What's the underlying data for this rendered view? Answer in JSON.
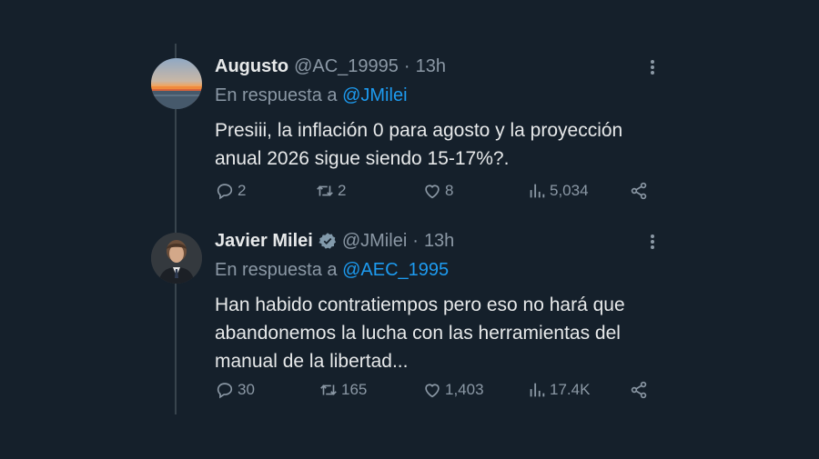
{
  "tweets": [
    {
      "display_name": "Augusto",
      "handle": "@AC_19995",
      "separator": "·",
      "time": "13h",
      "verified": false,
      "reply_prefix": "En respuesta a",
      "reply_to": "@JMilei",
      "text_lines": [
        "Presiii, la inflación 0 para agosto y la proyección",
        "anual 2026 sigue siendo 15-17%?."
      ],
      "replies": "2",
      "retweets": "2",
      "likes": "8",
      "views": "5,034"
    },
    {
      "display_name": "Javier Milei",
      "handle": "@JMilei",
      "separator": "·",
      "time": "13h",
      "verified": true,
      "reply_prefix": "En respuesta a",
      "reply_to": "@AEC_1995",
      "text_lines": [
        "Han habido contratiempos pero eso no hará que",
        "abandonemos la lucha con las herramientas del",
        "manual de la libertad..."
      ],
      "replies": "30",
      "retweets": "165",
      "likes": "1,403",
      "views": "17.4K"
    }
  ],
  "colors": {
    "background": "#15202b",
    "text": "#e7e9ea",
    "muted": "#8b98a5",
    "accent": "#1d9bf0",
    "thread_line": "#38444d"
  },
  "icons": [
    "reply-icon",
    "retweet-icon",
    "like-icon",
    "views-icon",
    "share-icon",
    "more-icon",
    "verified-badge-icon"
  ]
}
